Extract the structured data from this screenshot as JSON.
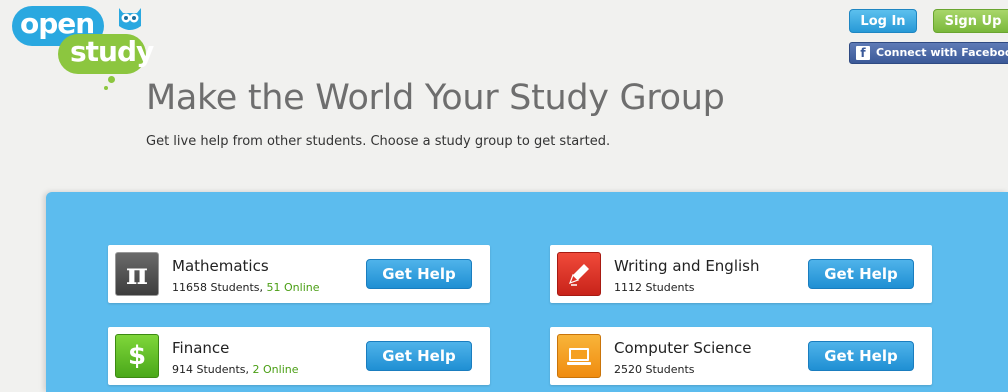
{
  "logo": {
    "word1": "open",
    "word2": "study",
    "mascot_icon": "owl-icon"
  },
  "header": {
    "login_label": "Log In",
    "signup_label": "Sign Up",
    "facebook_icon": "facebook-icon",
    "facebook_glyph": "f",
    "facebook_label": "Connect with Facebook"
  },
  "hero": {
    "title": "Make the World Your Study Group",
    "subtitle": "Get live help from other students. Choose a study group to get started."
  },
  "groups": [
    {
      "name": "Mathematics",
      "students": "11658 Students",
      "separator": ", ",
      "online": "51 Online",
      "button": "Get Help",
      "icon": "pi-icon",
      "icon_glyph": "π",
      "color": "#4a4a4a"
    },
    {
      "name": "Writing and English",
      "students": "1112 Students",
      "separator": "",
      "online": "",
      "button": "Get Help",
      "icon": "pen-icon",
      "icon_glyph": "",
      "color": "#e0332a"
    },
    {
      "name": "Finance",
      "students": "914 Students",
      "separator": ", ",
      "online": "2 Online",
      "button": "Get Help",
      "icon": "dollar-icon",
      "icon_glyph": "$",
      "color": "#5cbf25"
    },
    {
      "name": "Computer Science",
      "students": "2520 Students",
      "separator": "",
      "online": "",
      "button": "Get Help",
      "icon": "monitor-icon",
      "icon_glyph": "",
      "color": "#f5a020"
    }
  ],
  "colors": {
    "brand_blue": "#2aa8e0",
    "brand_green": "#8cc63f",
    "panel_blue": "#5cbcee",
    "online_green": "#4a9e14"
  }
}
